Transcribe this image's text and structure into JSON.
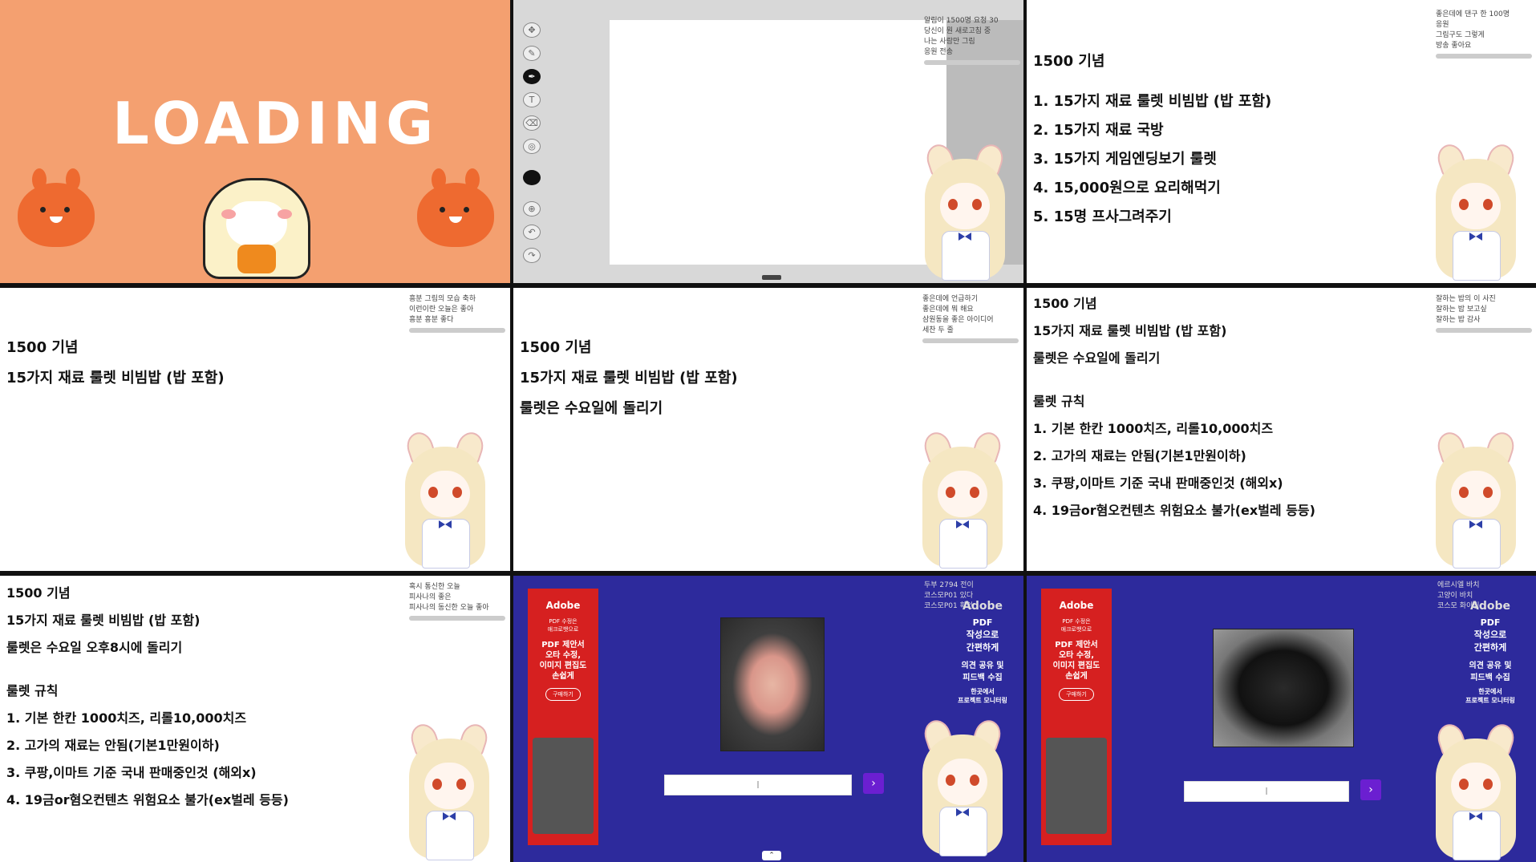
{
  "loading_panel": {
    "title": "LOADING"
  },
  "drawing_panel": {
    "tools": [
      "move-icon",
      "smudge-icon",
      "pen-icon",
      "text-icon",
      "eraser-icon",
      "shape-icon",
      "color-icon",
      "zoom-icon",
      "undo-icon",
      "redo-icon"
    ]
  },
  "panel3": {
    "title": "1500 기념",
    "items": [
      "1. 15가지 재료 룰렛 비빔밥 (밥 포함)",
      "2. 15가지 재료 국방",
      "3. 15가지 게임엔딩보기 룰렛",
      "4. 15,000원으로 요리해먹기",
      "5. 15명 프사그려주기"
    ]
  },
  "panel4": {
    "title": "1500 기념",
    "line1": "15가지 재료 룰렛 비빔밥 (밥 포함)"
  },
  "panel5": {
    "title": "1500 기념",
    "line1": "15가지 재료 룰렛 비빔밥 (밥 포함)",
    "line2": "룰렛은 수요일에 돌리기"
  },
  "panel6": {
    "title": "1500 기념",
    "line1": "15가지 재료 룰렛 비빔밥 (밥 포함)",
    "line2": "룰렛은 수요일에 돌리기",
    "rules_title": "룰렛 규칙",
    "rules": [
      "1. 기본 한칸 1000치즈, 리롤10,000치즈",
      "2. 고가의 재료는 안됨(기본1만원이하)",
      "3. 쿠팡,이마트 기준 국내 판매중인것 (해외x)",
      "4. 19금or혐오컨텐츠 위험요소 불가(ex벌레 등등)"
    ]
  },
  "panel7": {
    "title": "1500 기념",
    "line1": "15가지 재료 룰렛 비빔밥 (밥 포함)",
    "line2": "룰렛은 수요일 오후8시에 돌리기",
    "rules_title": "룰렛 규칙",
    "rules": [
      "1. 기본 한칸 1000치즈, 리롤10,000치즈",
      "2. 고가의 재료는 안됨(기본1만원이하)",
      "3. 쿠팡,이마트 기준 국내 판매중인것 (해외x)",
      "4. 19금or혐오컨텐츠 위험요소 불가(ex벌레 등등)"
    ]
  },
  "ad": {
    "brand": "Adobe",
    "sub": "PDF 수정은\n애크로뱃으로",
    "headline": "PDF 제안서\n오타 수정,\n이미지 편집도\n손쉽게",
    "cta": "구매하기",
    "overlay_headline": "PDF\n작성으로\n간편하게",
    "overlay_sub": "의견 공유 및\n피드백 수집",
    "overlay_small": "한곳에서\n프로젝트 모니터링"
  },
  "chat": {
    "p2": [
      "알림이 1500명 요청 30",
      "당신이 뭔 새로고침 중",
      "나는 사람만 그림",
      "응원 전송"
    ],
    "p3": [
      "좋은데에 댄구 한 100명",
      "응원",
      "그림구도 그렇게",
      "방송 좋아요"
    ],
    "p4": [
      "흥분 그림의 모습 축하",
      "이런이란 오늘은 좋아",
      "흥분 흥분 좋다"
    ],
    "p5": [
      "좋은데에 언급하기",
      "좋은데에 뭐 해요",
      "삼원동을 좋은 아이디어",
      "세찬 두 줄"
    ],
    "p6": [
      "잘하는 밥의 이 사진",
      "잘하는 밥 보고싶",
      "잘하는 밥 감사"
    ],
    "p7": [
      "혹시 통신한 오늘",
      "피사나의 좋은",
      "피사나의 동신한 오늘 좋아"
    ],
    "p8": [
      "두부 2794 전이",
      "코스모P01 있다",
      "코스모P01 확인"
    ],
    "p9": [
      "에르시엘 바치",
      "고양이 바치",
      "코스모 화이팅"
    ]
  },
  "colors": {
    "loading_bg": "#f4a070",
    "ad_red": "#d62020",
    "page_blue": "#2d2a9c",
    "button_purple": "#6b1fd1"
  }
}
